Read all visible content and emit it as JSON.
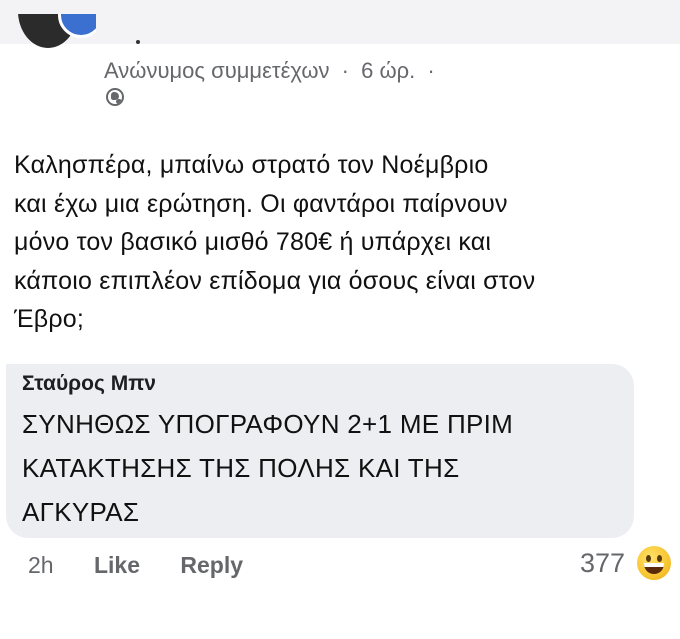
{
  "post": {
    "author": "Ανώνυμος συμμετέχων",
    "separator": "·",
    "time": "6 ώρ.",
    "trailing_dot": "·",
    "privacy_icon": "globe-icon",
    "body_lines": [
      "Καλησπέρα, μπαίνω στρατό τον Νοέμβριο",
      "και έχω μια ερώτηση. Οι φαντάροι παίρνουν",
      "μόνο τον βασικό μισθό 780€ ή υπάρχει και",
      "κάποιο επιπλέον επίδομα για όσους είναι στον",
      "Έβρο;"
    ]
  },
  "comment": {
    "author": "Σταύρος Μπν",
    "text_lines": [
      "ΣΥΝΗΘΩΣ ΥΠΟΓΡΑΦΟΥΝ 2+1 ΜΕ ΠΡΙΜ",
      "ΚΑΤΑΚΤΗΣΗΣ ΤΗΣ ΠΟΛΗΣ ΚΑΙ ΤΗΣ",
      "ΑΓΚΥΡΑΣ"
    ],
    "time": "2h",
    "like_label": "Like",
    "reply_label": "Reply",
    "reaction_count": "377",
    "reaction_icon": "laughing-emoji-icon"
  },
  "colors": {
    "meta_text": "#65676b",
    "bubble_bg": "#eceef2",
    "body_text": "#111111"
  }
}
